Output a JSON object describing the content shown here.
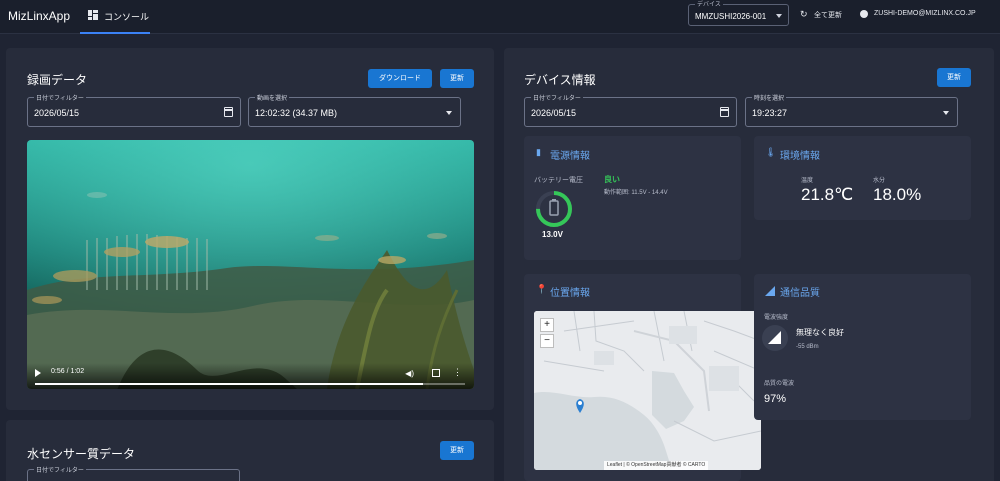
{
  "header": {
    "app_title": "MizLinxApp",
    "tab_console": "コンソール",
    "device_legend": "デバイス",
    "device_value": "MMZUSHI2026-001",
    "refresh_all": "全て更新",
    "user_email": "ZUSHI-DEMO@MIZLINX.CO.JP"
  },
  "recording": {
    "title": "録画データ",
    "download_label": "ダウンロード",
    "refresh_label": "更新",
    "date_legend": "日付でフィルター",
    "date_value": "2026/05/15",
    "video_legend": "動画を選択",
    "video_value": "12:02:32 (34.37 MB)",
    "video_time": "0:56 / 1:02",
    "progress_fraction": 0.903
  },
  "water": {
    "title": "水センサー質データ",
    "refresh_label": "更新",
    "date_legend": "日付でフィルター"
  },
  "device_info": {
    "title": "デバイス情報",
    "refresh_label": "更新",
    "date_legend": "日付でフィルター",
    "date_value": "2026/05/15",
    "time_legend": "時刻を選択",
    "time_value": "19:23:27",
    "power": {
      "title": "電源情報",
      "battery_label": "バッテリー電圧",
      "status": "良い",
      "range": "動作範囲: 11.5V - 14.4V",
      "voltage": "13.0V",
      "gauge_fraction": 0.75
    },
    "environment": {
      "title": "環境情報",
      "temp_label": "温度",
      "temp_value": "21.8℃",
      "humidity_label": "水分",
      "humidity_value": "18.0%"
    },
    "location": {
      "title": "位置情報",
      "zoom_in": "+",
      "zoom_out": "−",
      "attribution": "Leaflet | © OpenStreetMap貢献者 © CARTO"
    },
    "signal": {
      "title": "通信品質",
      "strength_label": "電波強度",
      "strength_status": "無理なく良好",
      "strength_dbm": "-55 dBm",
      "quality_label": "品質の電波",
      "quality_value": "97%"
    }
  },
  "colors": {
    "accent": "#1976d2",
    "good": "#35c759",
    "subtitle": "#6aa8f0"
  }
}
